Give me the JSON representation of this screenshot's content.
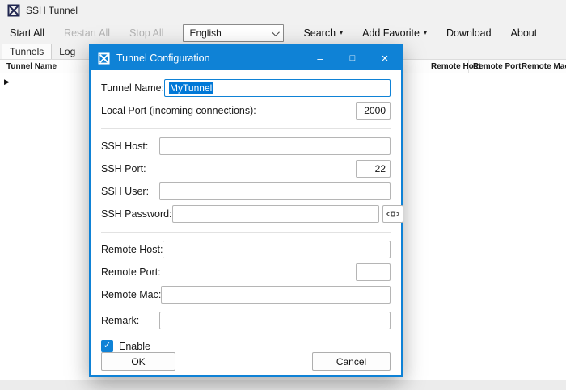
{
  "window": {
    "title": "SSH Tunnel"
  },
  "toolbar": {
    "start_all": "Start All",
    "restart_all": "Restart All",
    "stop_all": "Stop All",
    "language_selected": "English",
    "search": "Search",
    "add_favorite": "Add Favorite",
    "download": "Download",
    "about": "About"
  },
  "tabs": [
    {
      "label": "Tunnels",
      "active": true
    },
    {
      "label": "Log",
      "active": false
    }
  ],
  "table": {
    "columns": [
      "Tunnel Name",
      "Remote Host",
      "Remote Port",
      "Remote Mac"
    ]
  },
  "icons": {
    "caret": "▾",
    "check": "✓",
    "row_indicator": "▶",
    "minimize": "–",
    "maximize": "□",
    "close": "×"
  },
  "dialog": {
    "title": "Tunnel Configuration",
    "fields": {
      "tunnel_name": {
        "label": "Tunnel Name:",
        "value": "MyTunnel"
      },
      "local_port": {
        "label": "Local Port (incoming connections):",
        "value": "2000"
      },
      "ssh_host": {
        "label": "SSH Host:",
        "value": ""
      },
      "ssh_port": {
        "label": "SSH Port:",
        "value": "22"
      },
      "ssh_user": {
        "label": "SSH User:",
        "value": ""
      },
      "ssh_password": {
        "label": "SSH Password:",
        "value": ""
      },
      "remote_host": {
        "label": "Remote Host:",
        "value": ""
      },
      "remote_port": {
        "label": "Remote Port:",
        "value": ""
      },
      "remote_mac": {
        "label": "Remote Mac:",
        "value": ""
      },
      "remark": {
        "label": "Remark:",
        "value": ""
      }
    },
    "enable": {
      "label": "Enable",
      "checked": true
    },
    "buttons": {
      "ok": "OK",
      "cancel": "Cancel"
    }
  },
  "colors": {
    "accent": "#0f82d6",
    "selection": "#0078d7",
    "disabled_text": "#b3b3b3"
  }
}
